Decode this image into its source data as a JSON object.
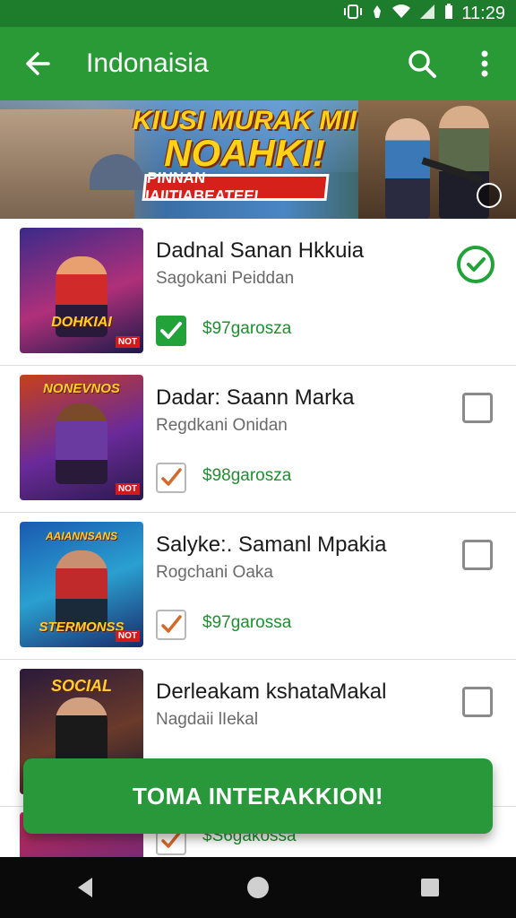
{
  "status_bar": {
    "time": "11:29"
  },
  "app_bar": {
    "title": "Indonaisia"
  },
  "banner": {
    "headline_line1": "KIUSI MURAK MII",
    "headline_line2": "NOAHKI!",
    "tag": "PINNAN IAIITIABEATEEL"
  },
  "items": [
    {
      "name": "Dadnal Sanan Hkkuia",
      "subtitle": "Sagokani Peiddan",
      "price": "$97garosza",
      "thumb_caption": "DOHKIAI",
      "selected": true
    },
    {
      "name": "Dadar: Saann Marka",
      "subtitle": "Regdkani Onidan",
      "price": "$98garosza",
      "thumb_caption": "NONEVNOS",
      "selected": false
    },
    {
      "name": "Salyke:. Samanl Mpakia",
      "subtitle": "Rogchani Oaka",
      "price": "$97garossa",
      "thumb_caption": "STERMONSS",
      "selected": false
    },
    {
      "name": "Derleakam kshataMakal",
      "subtitle": "Nagdaii lIekal",
      "price": "",
      "thumb_caption": "SOCIAL",
      "selected": false
    },
    {
      "name": "",
      "subtitle": "",
      "price": "$S6gakossa",
      "thumb_caption": "",
      "selected": false
    }
  ],
  "fab": {
    "label": "TOMA INTERAKKION!"
  },
  "colors": {
    "primary": "#2a9a37",
    "status": "#1e7d2c",
    "price": "#1f8f2f",
    "check_orange": "#d36a2a"
  }
}
